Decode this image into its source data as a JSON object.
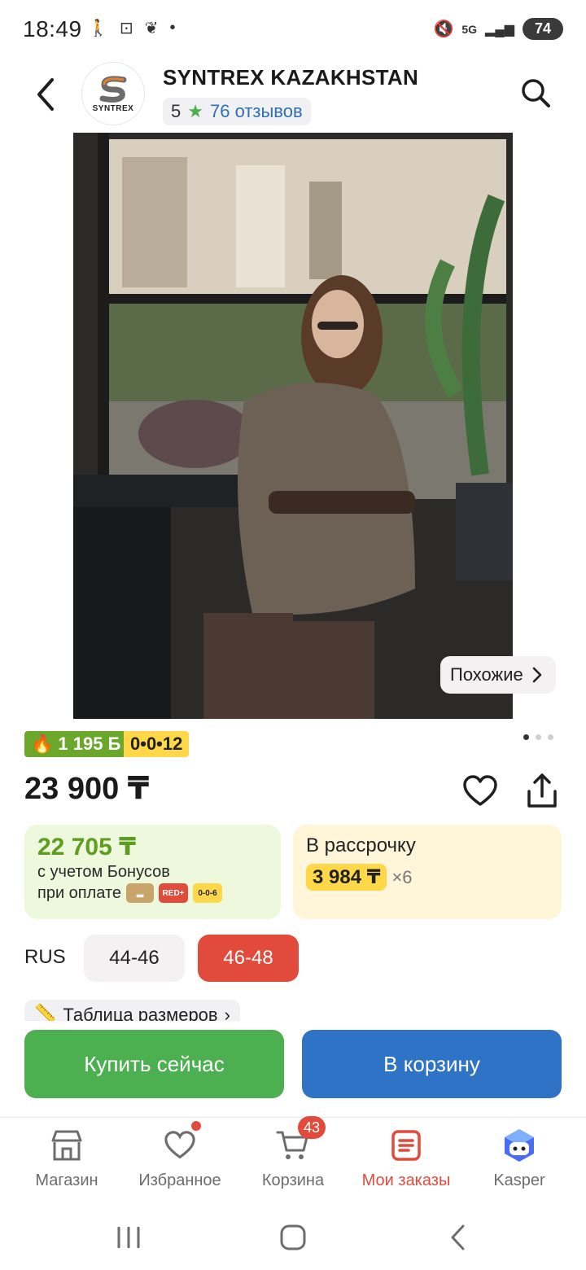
{
  "status_bar": {
    "time": "18:49",
    "network": "5G",
    "battery": "74"
  },
  "header": {
    "logo_text": "SYNTREX",
    "store_name": "SYNTREX KAZAKHSTAN",
    "rating": "5",
    "reviews": "76 отзывов",
    "icons": [
      "back-arrow-icon",
      "search-icon"
    ]
  },
  "product": {
    "similar_label": "Похожие",
    "bonus_badge": "1 195 Б",
    "installment_badge": "0•0•12",
    "price": "23 900 ₸",
    "image_count": 3,
    "active_image": 1
  },
  "bonus_card": {
    "value": "22 705 ₸",
    "line1": "с учетом Бонусов",
    "line2": "при оплате",
    "pay_icons": [
      "Kaspi",
      "RED+",
      "0-0-6"
    ]
  },
  "installment_card": {
    "title": "В рассрочку",
    "monthly": "3 984 ₸",
    "multiplier": "×6"
  },
  "sizes": {
    "system": "RUS",
    "options": [
      "44-46",
      "46-48"
    ],
    "selected": "46-48",
    "table_link": "Таблица размеров"
  },
  "actions": {
    "buy_now": "Купить сейчас",
    "to_cart": "В корзину"
  },
  "bottom_nav": {
    "items": [
      {
        "label": "Магазин",
        "icon": "store-icon"
      },
      {
        "label": "Избранное",
        "icon": "heart-icon",
        "dot": true
      },
      {
        "label": "Корзина",
        "icon": "cart-icon",
        "count": "43"
      },
      {
        "label": "Мои заказы",
        "icon": "orders-icon",
        "active": true
      },
      {
        "label": "Kasper",
        "icon": "kasper-icon"
      }
    ]
  },
  "colors": {
    "green": "#4caf50",
    "blue": "#2f73c6",
    "red": "#e24b3b",
    "yellow": "#ffd84a",
    "bonus_bg": "#eef8dd",
    "installment_bg": "#fff6da"
  }
}
